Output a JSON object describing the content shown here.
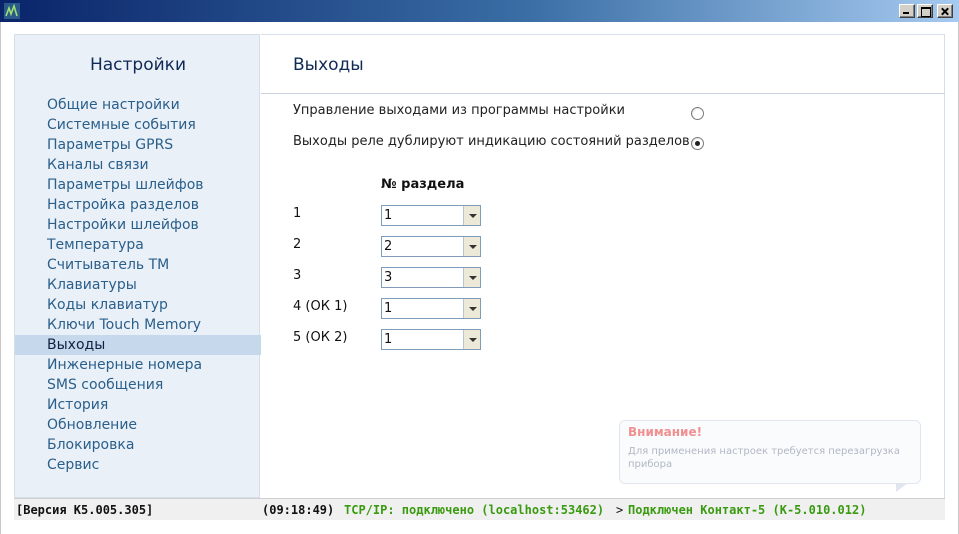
{
  "window": {
    "title": "",
    "buttons": [
      "minimize",
      "maximize",
      "close"
    ],
    "accent_color": "#0a246a"
  },
  "sidebar": {
    "title": "Настройки",
    "items": [
      {
        "label": "Общие настройки",
        "active": false
      },
      {
        "label": "Системные события",
        "active": false
      },
      {
        "label": "Параметры GPRS",
        "active": false
      },
      {
        "label": "Каналы связи",
        "active": false
      },
      {
        "label": "Параметры шлейфов",
        "active": false
      },
      {
        "label": "Настройка разделов",
        "active": false
      },
      {
        "label": "Настройки шлейфов",
        "active": false
      },
      {
        "label": "Температура",
        "active": false
      },
      {
        "label": "Считыватель ТМ",
        "active": false
      },
      {
        "label": "Клавиатуры",
        "active": false
      },
      {
        "label": "Коды клавиатур",
        "active": false
      },
      {
        "label": "Ключи Touch Memory",
        "active": false
      },
      {
        "label": "Выходы",
        "active": true
      },
      {
        "label": "Инженерные номера",
        "active": false
      },
      {
        "label": "SMS сообщения",
        "active": false
      },
      {
        "label": "История",
        "active": false
      },
      {
        "label": "Обновление",
        "active": false
      },
      {
        "label": "Блокировка",
        "active": false
      },
      {
        "label": "Сервис",
        "active": false
      }
    ]
  },
  "main": {
    "title": "Выходы",
    "options": [
      {
        "label": "Управление выходами из программы настройки",
        "checked": false
      },
      {
        "label": "Выходы реле дублируют индикацию состояний разделов",
        "checked": true
      }
    ],
    "column_header": "№ раздела",
    "rows": [
      {
        "label": "1",
        "value": "1"
      },
      {
        "label": "2",
        "value": "2"
      },
      {
        "label": "3",
        "value": "3"
      },
      {
        "label": "4 (ОК 1)",
        "value": "1"
      },
      {
        "label": "5 (ОК 2)",
        "value": "1"
      }
    ]
  },
  "notice": {
    "title": "Внимание!",
    "text": "Для применения настроек требуется перезагрузка прибора"
  },
  "status": {
    "version": "[Версия K5.005.305]",
    "time": "(09:18:49)",
    "connection": "TCP/IP: подключено (localhost:53462)",
    "arrow": ">",
    "device": "Подключен Контакт-5 (K-5.010.012)",
    "ok_color": "#3a9a10"
  }
}
